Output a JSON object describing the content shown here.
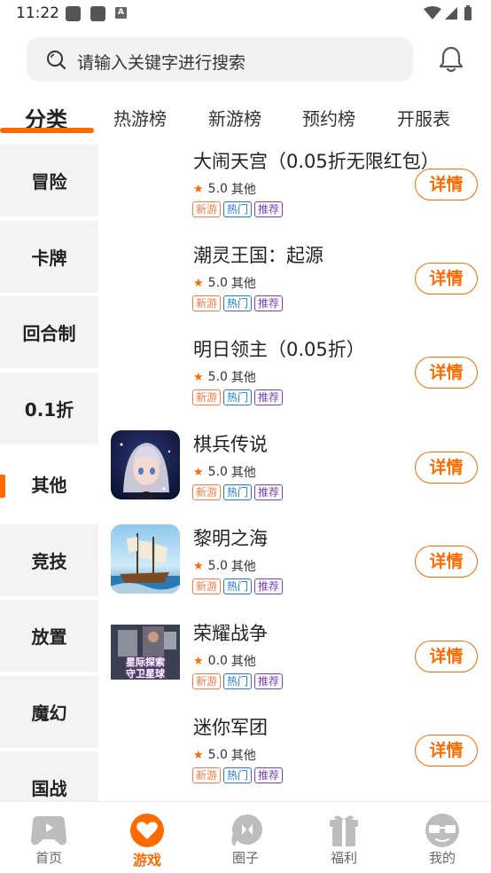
{
  "status": {
    "time": "11:22",
    "a_glyph": "A"
  },
  "search": {
    "placeholder": "请输入关键字进行搜索"
  },
  "tabs": [
    "分类",
    "热游榜",
    "新游榜",
    "预约榜",
    "开服表"
  ],
  "sidebar": [
    "冒险",
    "卡牌",
    "回合制",
    "0.1折",
    "其他",
    "竞技",
    "放置",
    "魔幻",
    "国战"
  ],
  "tags": {
    "new": "新游",
    "hot": "热门",
    "rec": "推荐"
  },
  "detail_label": "详情",
  "games": [
    {
      "name": "大闹天宫（0.05折无限红包）",
      "rating": "5.0",
      "category": "其他"
    },
    {
      "name": "潮灵王国：起源",
      "rating": "5.0",
      "category": "其他"
    },
    {
      "name": "明日领主（0.05折）",
      "rating": "5.0",
      "category": "其他"
    },
    {
      "name": "棋兵传说",
      "rating": "5.0",
      "category": "其他"
    },
    {
      "name": "黎明之海",
      "rating": "5.0",
      "category": "其他"
    },
    {
      "name": "荣耀战争",
      "rating": "0.0",
      "category": "其他",
      "thumb_text_1": "星际探索",
      "thumb_text_2": "守卫星球"
    },
    {
      "name": "迷你军团",
      "rating": "5.0",
      "category": "其他"
    }
  ],
  "bottom_nav": [
    "首页",
    "游戏",
    "圈子",
    "福利",
    "我的"
  ],
  "colors": {
    "accent": "#ff6a00",
    "tag_new": "#ff7a45",
    "tag_hot": "#1e7be6",
    "tag_rec": "#7a3fc8"
  }
}
